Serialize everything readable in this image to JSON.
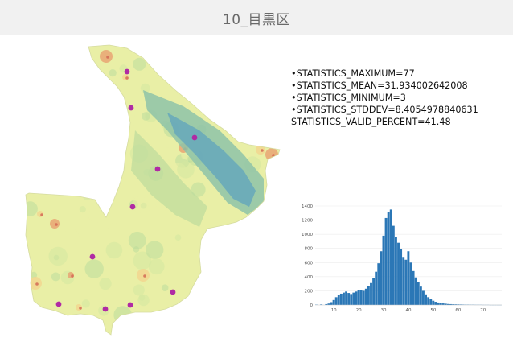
{
  "header": {
    "title": "10_目黒区"
  },
  "stats": {
    "lines": [
      "•STATISTICS_MAXIMUM=77",
      "•STATISTICS_MEAN=31.934002642008",
      "•STATISTICS_MINIMUM=3",
      "•STATISTICS_STDDEV=8.4054978840631",
      "STATISTICS_VALID_PERCENT=41.48"
    ]
  },
  "map": {
    "fill_colors": [
      "#e9efa6",
      "#d4e8a0",
      "#bcdc9c",
      "#8ec3a8",
      "#5fa3bd",
      "#f2d58e",
      "#e8a070",
      "#d36a55"
    ],
    "marker_color": "#b02aa4",
    "marker_count": 10
  },
  "chart_data": {
    "type": "bar",
    "title": "",
    "xlabel": "",
    "ylabel": "",
    "xlim": [
      3,
      77
    ],
    "ylim": [
      0,
      1400
    ],
    "x_ticks": [
      10,
      20,
      30,
      40,
      50,
      60,
      70
    ],
    "y_ticks": [
      0,
      200,
      400,
      600,
      800,
      1000,
      1200,
      1400
    ],
    "bar_color": "#2b77b6",
    "bins": [
      {
        "x": 3,
        "y": 5
      },
      {
        "x": 5,
        "y": 8
      },
      {
        "x": 7,
        "y": 12
      },
      {
        "x": 8,
        "y": 20
      },
      {
        "x": 9,
        "y": 40
      },
      {
        "x": 10,
        "y": 70
      },
      {
        "x": 11,
        "y": 110
      },
      {
        "x": 12,
        "y": 140
      },
      {
        "x": 13,
        "y": 160
      },
      {
        "x": 14,
        "y": 175
      },
      {
        "x": 15,
        "y": 190
      },
      {
        "x": 16,
        "y": 170
      },
      {
        "x": 17,
        "y": 155
      },
      {
        "x": 18,
        "y": 175
      },
      {
        "x": 19,
        "y": 190
      },
      {
        "x": 20,
        "y": 205
      },
      {
        "x": 21,
        "y": 215
      },
      {
        "x": 22,
        "y": 200
      },
      {
        "x": 23,
        "y": 230
      },
      {
        "x": 24,
        "y": 270
      },
      {
        "x": 25,
        "y": 310
      },
      {
        "x": 26,
        "y": 380
      },
      {
        "x": 27,
        "y": 470
      },
      {
        "x": 28,
        "y": 590
      },
      {
        "x": 29,
        "y": 760
      },
      {
        "x": 30,
        "y": 980
      },
      {
        "x": 31,
        "y": 1230
      },
      {
        "x": 32,
        "y": 1310
      },
      {
        "x": 33,
        "y": 1350
      },
      {
        "x": 34,
        "y": 1120
      },
      {
        "x": 35,
        "y": 960
      },
      {
        "x": 36,
        "y": 880
      },
      {
        "x": 37,
        "y": 790
      },
      {
        "x": 38,
        "y": 680
      },
      {
        "x": 39,
        "y": 640
      },
      {
        "x": 40,
        "y": 760
      },
      {
        "x": 41,
        "y": 600
      },
      {
        "x": 42,
        "y": 480
      },
      {
        "x": 43,
        "y": 390
      },
      {
        "x": 44,
        "y": 330
      },
      {
        "x": 45,
        "y": 260
      },
      {
        "x": 46,
        "y": 200
      },
      {
        "x": 47,
        "y": 150
      },
      {
        "x": 48,
        "y": 110
      },
      {
        "x": 49,
        "y": 80
      },
      {
        "x": 50,
        "y": 60
      },
      {
        "x": 51,
        "y": 45
      },
      {
        "x": 52,
        "y": 35
      },
      {
        "x": 53,
        "y": 28
      },
      {
        "x": 54,
        "y": 22
      },
      {
        "x": 55,
        "y": 18
      },
      {
        "x": 56,
        "y": 14
      },
      {
        "x": 57,
        "y": 12
      },
      {
        "x": 58,
        "y": 10
      },
      {
        "x": 59,
        "y": 9
      },
      {
        "x": 60,
        "y": 8
      },
      {
        "x": 61,
        "y": 7
      },
      {
        "x": 62,
        "y": 6
      },
      {
        "x": 63,
        "y": 5
      },
      {
        "x": 64,
        "y": 5
      },
      {
        "x": 65,
        "y": 4
      },
      {
        "x": 66,
        "y": 4
      },
      {
        "x": 67,
        "y": 3
      },
      {
        "x": 68,
        "y": 3
      },
      {
        "x": 69,
        "y": 3
      },
      {
        "x": 70,
        "y": 2
      },
      {
        "x": 71,
        "y": 2
      },
      {
        "x": 72,
        "y": 2
      },
      {
        "x": 73,
        "y": 1
      },
      {
        "x": 74,
        "y": 1
      },
      {
        "x": 75,
        "y": 1
      },
      {
        "x": 76,
        "y": 1
      },
      {
        "x": 77,
        "y": 1
      }
    ]
  }
}
